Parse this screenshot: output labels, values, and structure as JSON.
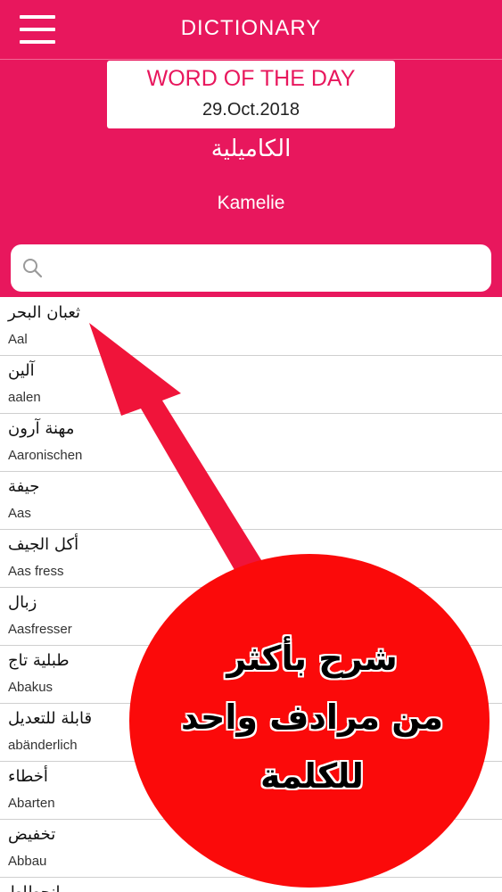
{
  "app": {
    "title": "DICTIONARY"
  },
  "word_of_the_day": {
    "heading": "WORD OF THE DAY",
    "date": "29.Oct.2018",
    "arabic": "الكاميلية",
    "german": "Kamelie"
  },
  "search": {
    "value": "",
    "placeholder": ""
  },
  "entries": [
    {
      "ar": "ثعبان البحر",
      "de": "Aal"
    },
    {
      "ar": "آلين",
      "de": "aalen"
    },
    {
      "ar": "مهنة آرون",
      "de": "Aaronischen"
    },
    {
      "ar": "جيفة",
      "de": "Aas"
    },
    {
      "ar": "أكل الجيف",
      "de": "Aas fress"
    },
    {
      "ar": "زبال",
      "de": "Aasfresser"
    },
    {
      "ar": "طبلية تاج",
      "de": "Abakus"
    },
    {
      "ar": "قابلة للتعديل",
      "de": "abänderlich"
    },
    {
      "ar": "أخطاء",
      "de": "Abarten"
    },
    {
      "ar": "تخفيض",
      "de": "Abbau"
    },
    {
      "ar": "انحطاط",
      "de": ""
    }
  ],
  "annotation": {
    "lines": [
      "شرح بأكثر",
      "من مرادف واحد",
      "للكلمة"
    ],
    "bubble_color": "#fb0a0a",
    "arrow_color": "#f0143a"
  },
  "colors": {
    "brand": "#e8175d",
    "white": "#ffffff",
    "divider": "#cfcfcf"
  }
}
